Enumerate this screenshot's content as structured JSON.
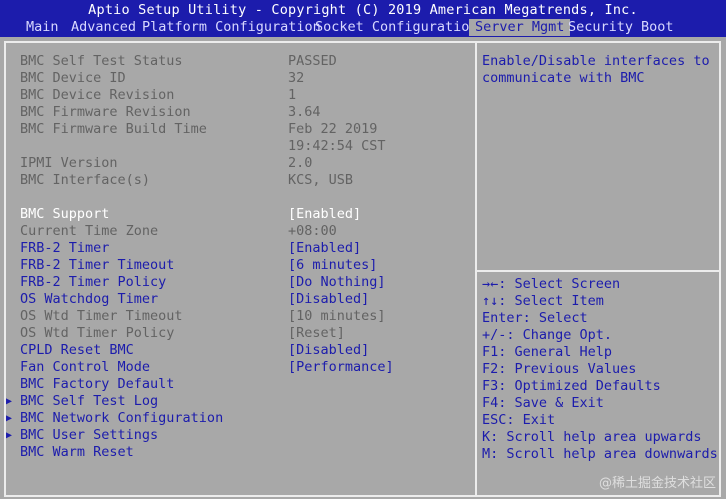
{
  "header": {
    "title": "Aptio Setup Utility - Copyright (C) 2019 American Megatrends, Inc.",
    "tabs": [
      "Main",
      "Advanced",
      "Platform Configuration",
      "Socket Configuration",
      "Server Mgmt",
      "Security",
      "Boot"
    ],
    "active_tab": "Server Mgmt"
  },
  "settings": [
    {
      "label": "BMC Self Test Status",
      "value": "PASSED"
    },
    {
      "label": "BMC Device ID",
      "value": "32"
    },
    {
      "label": "BMC Device Revision",
      "value": "1"
    },
    {
      "label": "BMC Firmware Revision",
      "value": "3.64"
    },
    {
      "label": "BMC Firmware Build Time",
      "value": "Feb 22 2019"
    },
    {
      "label": "",
      "value": "19:42:54 CST"
    },
    {
      "label": "IPMI Version",
      "value": "2.0"
    },
    {
      "label": "BMC Interface(s)",
      "value": "KCS, USB"
    },
    {
      "label": "BMC Support",
      "value": "[Enabled]"
    },
    {
      "label": "Current Time Zone",
      "value": "+08:00"
    },
    {
      "label": "FRB-2 Timer",
      "value": "[Enabled]"
    },
    {
      "label": "FRB-2 Timer Timeout",
      "value": "[6 minutes]"
    },
    {
      "label": "FRB-2 Timer Policy",
      "value": "[Do Nothing]"
    },
    {
      "label": "OS Watchdog Timer",
      "value": "[Disabled]"
    },
    {
      "label": "OS Wtd Timer Timeout",
      "value": "[10 minutes]"
    },
    {
      "label": "OS Wtd Timer Policy",
      "value": "[Reset]"
    },
    {
      "label": "CPLD Reset BMC",
      "value": "[Disabled]"
    },
    {
      "label": "Fan Control Mode",
      "value": "[Performance]"
    },
    {
      "label": "BMC Factory Default",
      "value": ""
    },
    {
      "label": "BMC Self Test Log",
      "value": ""
    },
    {
      "label": "BMC Network Configuration",
      "value": ""
    },
    {
      "label": "BMC User Settings",
      "value": ""
    },
    {
      "label": "BMC Warm Reset",
      "value": ""
    }
  ],
  "help": {
    "text": "Enable/Disable interfaces to communicate with BMC"
  },
  "keys": [
    "→←: Select Screen",
    "↑↓: Select Item",
    "Enter: Select",
    "+/-: Change Opt.",
    "F1: General Help",
    "F2: Previous Values",
    "F3: Optimized Defaults",
    "F4: Save & Exit",
    "ESC: Exit",
    "K: Scroll help area upwards",
    "M: Scroll help area downwards"
  ],
  "watermark": "@稀土掘金技术社区",
  "colors": {
    "background": "#a8a8a8",
    "header": "#1c1cac",
    "selectable": "#1c1cac",
    "info": "#636363",
    "selected": "#ffffff"
  }
}
